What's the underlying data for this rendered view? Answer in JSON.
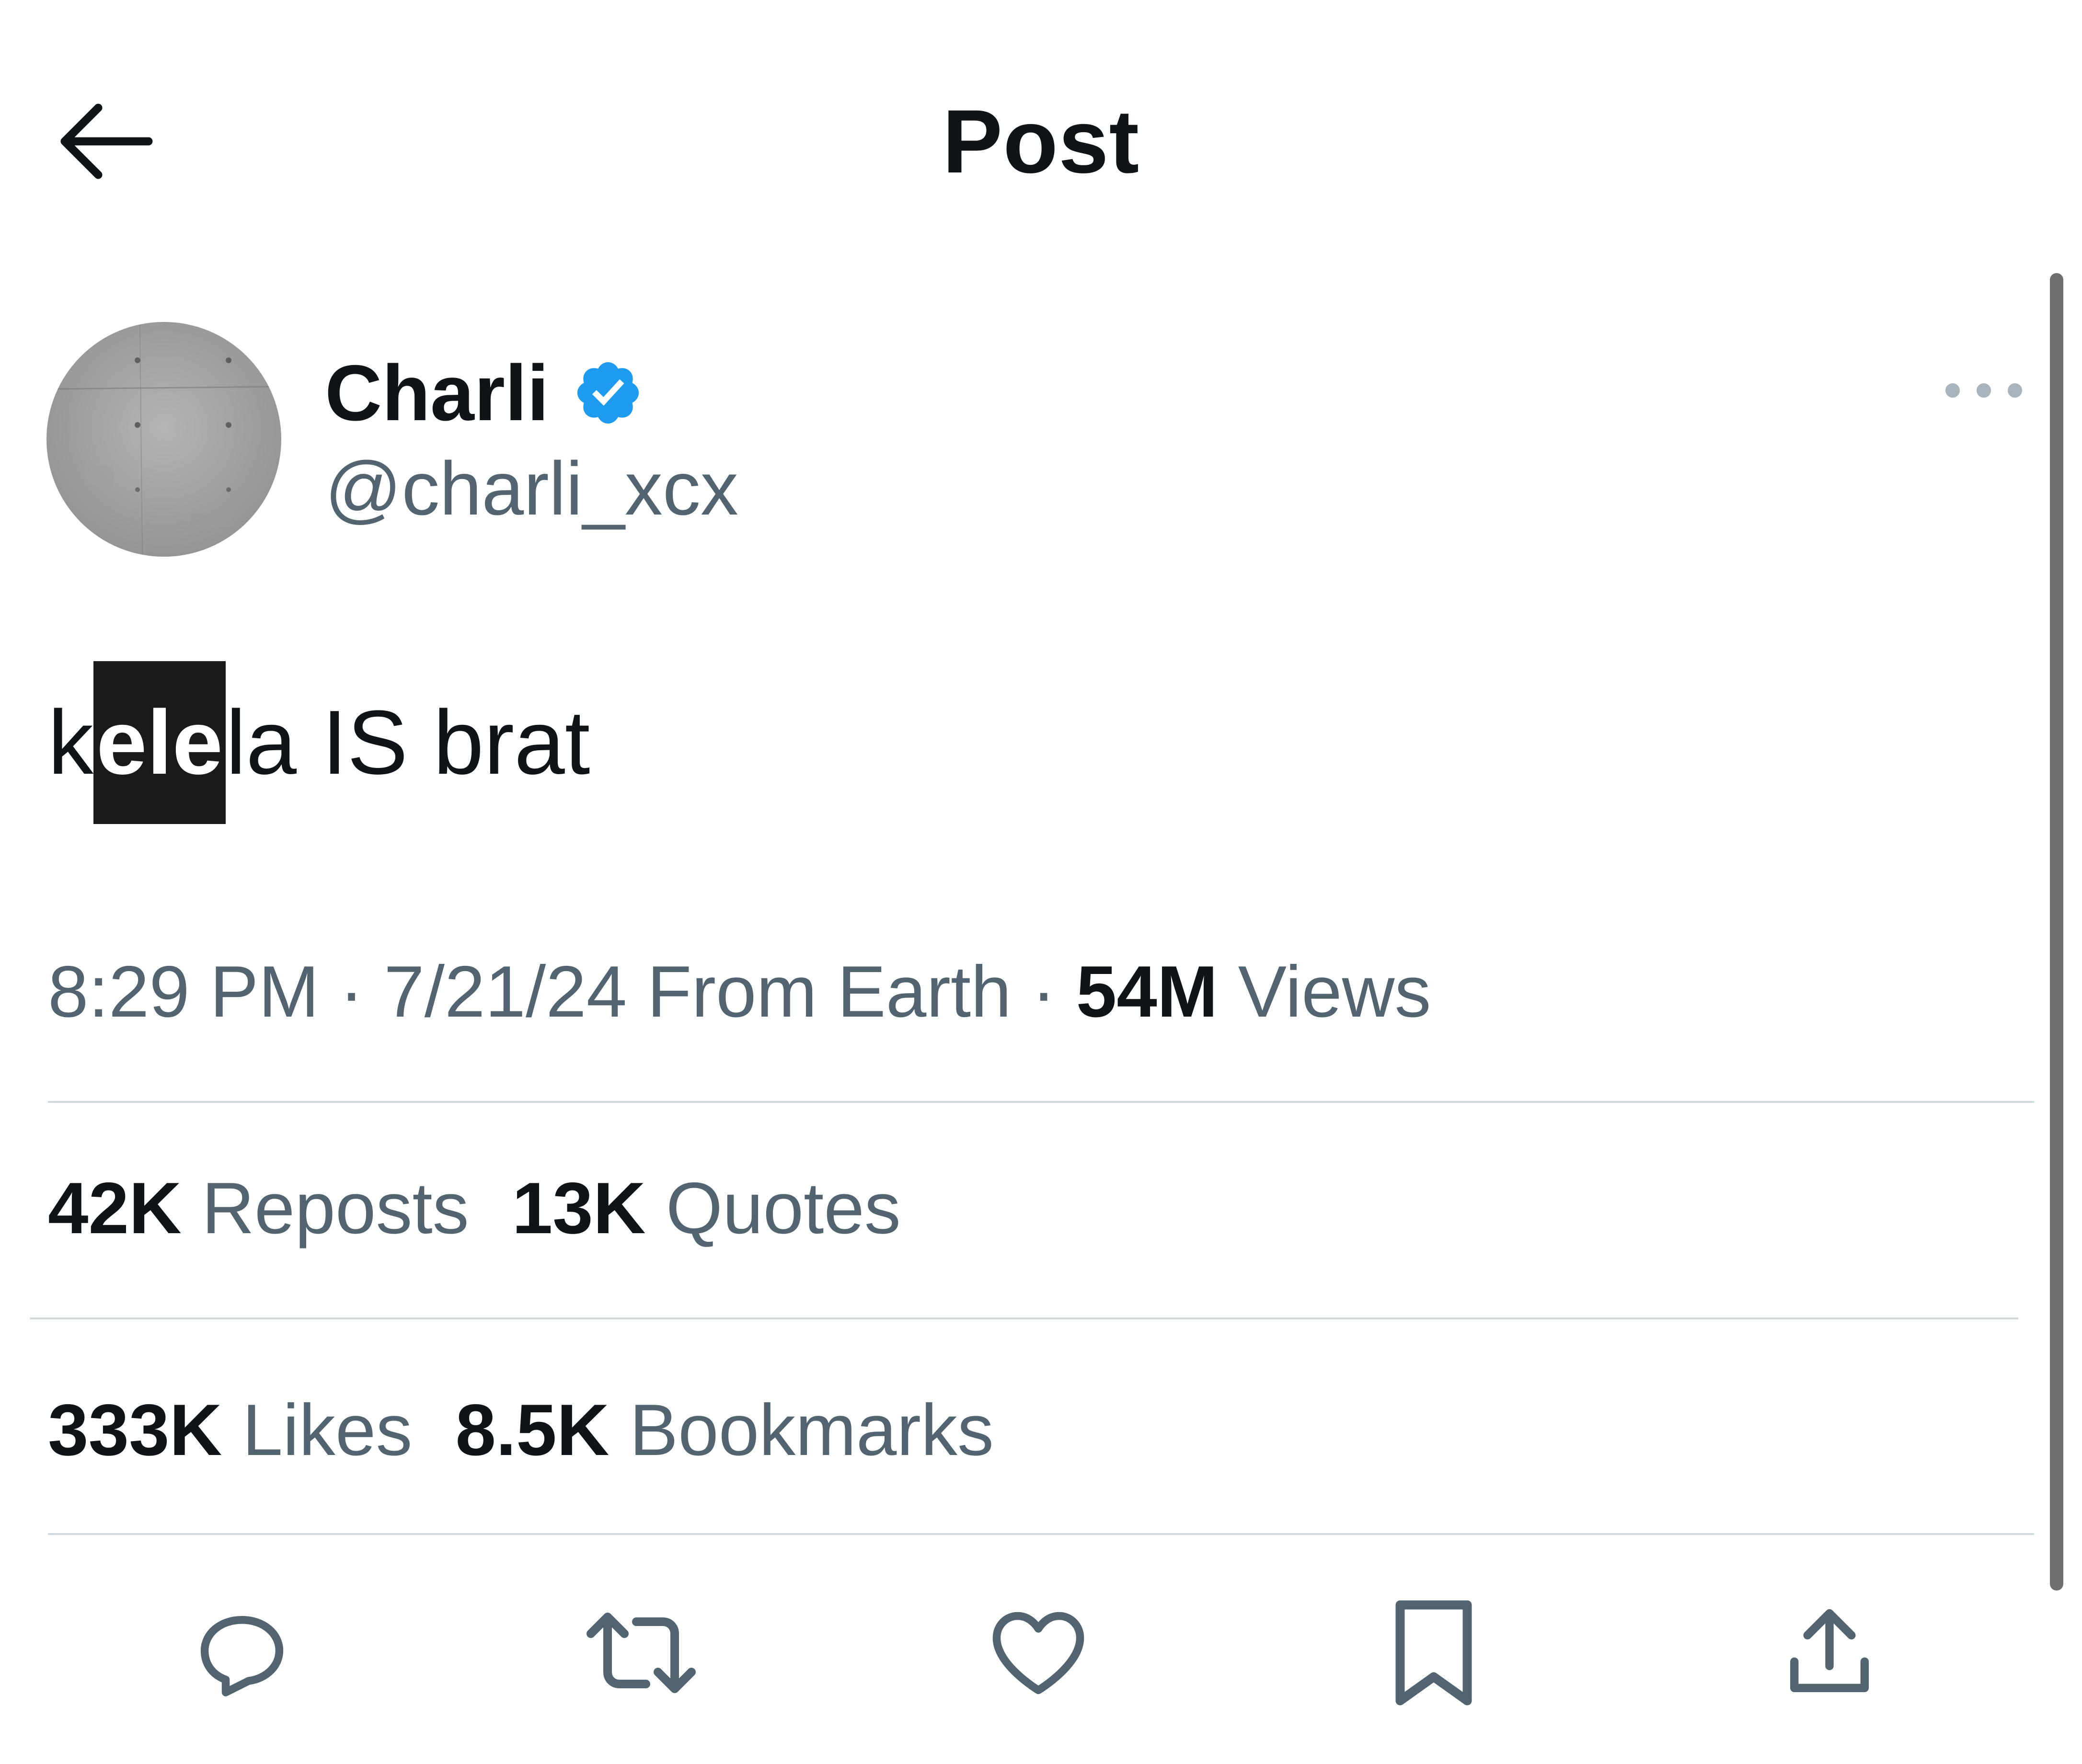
{
  "header": {
    "back_icon": "arrow-left-icon",
    "title": "Post"
  },
  "author": {
    "display_name": "Charli",
    "handle": "@charli_xcx",
    "verified_icon": "verified-badge-icon",
    "verified_color": "#1d9bf0",
    "more_icon": "more-horizontal-icon"
  },
  "post": {
    "text_prefix": "k",
    "text_highlight": "ele",
    "text_suffix": "la IS brat"
  },
  "meta": {
    "time": "8:29 PM",
    "separator": "·",
    "date": "7/21/24",
    "location": "From Earth",
    "views_count": "54M",
    "views_label": "Views"
  },
  "stats": {
    "reposts_count": "42K",
    "reposts_label": "Reposts",
    "quotes_count": "13K",
    "quotes_label": "Quotes",
    "likes_count": "333K",
    "likes_label": "Likes",
    "bookmarks_count": "8.5K",
    "bookmarks_label": "Bookmarks"
  },
  "actions": [
    "reply-icon",
    "repost-icon",
    "like-icon",
    "bookmark-icon",
    "share-icon"
  ],
  "colors": {
    "text_primary": "#0f1419",
    "text_secondary": "#536471",
    "divider": "#cfd9de",
    "highlight_bg": "#1a1a1a"
  }
}
